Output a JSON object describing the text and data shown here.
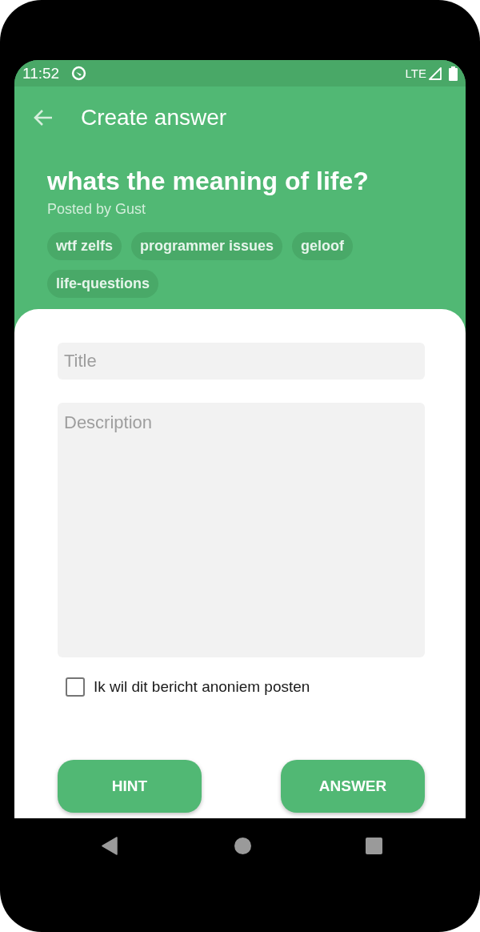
{
  "status_bar": {
    "time": "11:52",
    "network": "LTE"
  },
  "app_bar": {
    "title": "Create answer"
  },
  "question": {
    "title": "whats the meaning of life?",
    "author_line": "Posted by Gust",
    "tags": [
      "wtf zelfs",
      "programmer issues",
      "geloof",
      "life-questions"
    ]
  },
  "form": {
    "title_field": {
      "placeholder": "Title"
    },
    "description_field": {
      "placeholder": "Description"
    },
    "anonymous": {
      "label": "Ik wil dit bericht anoniem posten",
      "checked": false
    }
  },
  "buttons": [
    {
      "label": "HINT"
    },
    {
      "label": "ANSWER"
    }
  ]
}
